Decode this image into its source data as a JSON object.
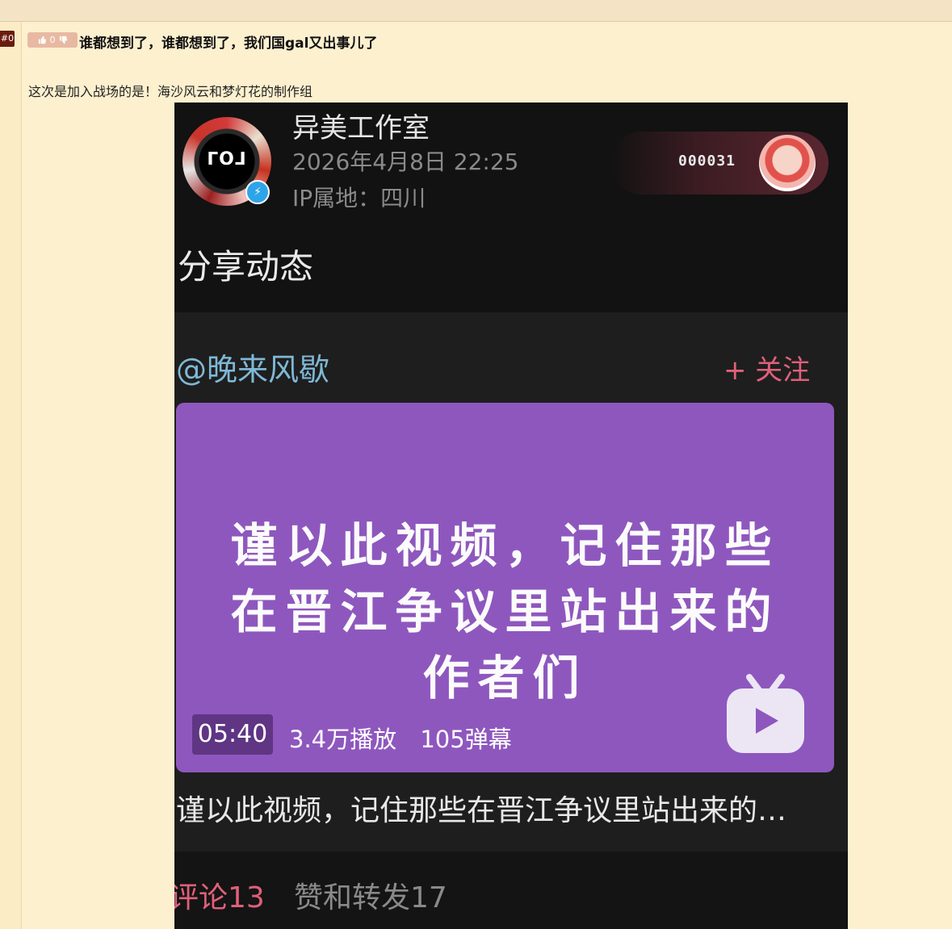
{
  "forum": {
    "floor_label": "#0",
    "vote_count": "0",
    "post_title": "谁都想到了，谁都想到了，我们国gal又出事儿了",
    "post_body": "这次是加入战场的是！海沙风云和梦灯花的制作组"
  },
  "screenshot": {
    "studio_name": "异美工作室",
    "post_time": "2026年4月8日 22:25",
    "ip_location": "IP属地：四川",
    "fan_number": "000031",
    "share_label": "分享动态",
    "mention": "@晚来风歇",
    "follow_label": "+ 关注",
    "video": {
      "text_lines": [
        "谨以此视频，记住那些",
        "在晋江争议里站出来的",
        "作者们"
      ],
      "duration": "05:40",
      "views": "3.4万播放",
      "danmaku": "105弹幕"
    },
    "video_caption": "谨以此视频，记住那些在晋江争议里站出来的…",
    "tabs": {
      "comments": "评论13",
      "likes_reposts": "赞和转发17"
    }
  },
  "colors": {
    "page_bg": "#fdf0cf",
    "floor_badge": "#6b1c0d",
    "vote_pill": "#e8b9a2",
    "video_bg": "#8e57be",
    "accent_pink": "#e0607a",
    "mention_blue": "#7fb8d6"
  },
  "icons": [
    "thumbs-up-icon",
    "thumbs-down-icon",
    "lightning-badge-icon",
    "bilibili-tv-play-icon"
  ]
}
